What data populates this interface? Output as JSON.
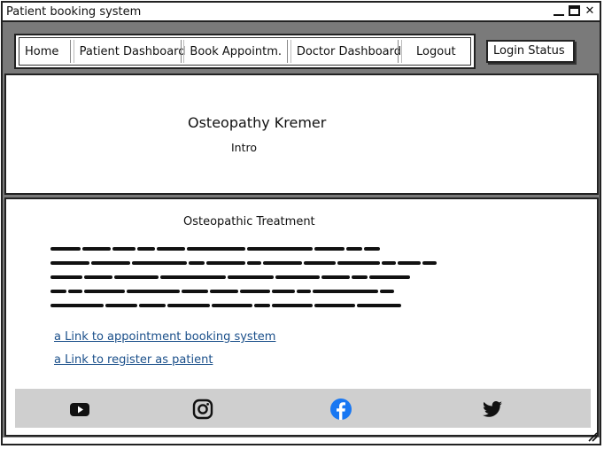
{
  "window": {
    "title": "Patient booking system",
    "close_glyph": "✕"
  },
  "nav": {
    "items": [
      {
        "label": "Home"
      },
      {
        "label": "Patient Dashboard"
      },
      {
        "label": "Book Appointm."
      },
      {
        "label": "Doctor Dashboard"
      },
      {
        "label": "Logout"
      }
    ]
  },
  "login_status": "Login Status",
  "hero": {
    "title": "Osteopathy Kremer",
    "subtitle": "Intro"
  },
  "main": {
    "section_title": "Osteopathic Treatment",
    "links": [
      {
        "label": "a Link to appointment booking system"
      },
      {
        "label": "a Link to register as patient"
      }
    ]
  },
  "footer": {
    "icons": [
      "youtube-icon",
      "instagram-icon",
      "facebook-icon",
      "twitter-icon"
    ]
  },
  "colors": {
    "link": "#1a4f8a",
    "facebook": "#1877f2",
    "footer_bg": "#cfcfcf",
    "frame_bg": "#7a7a7a"
  }
}
